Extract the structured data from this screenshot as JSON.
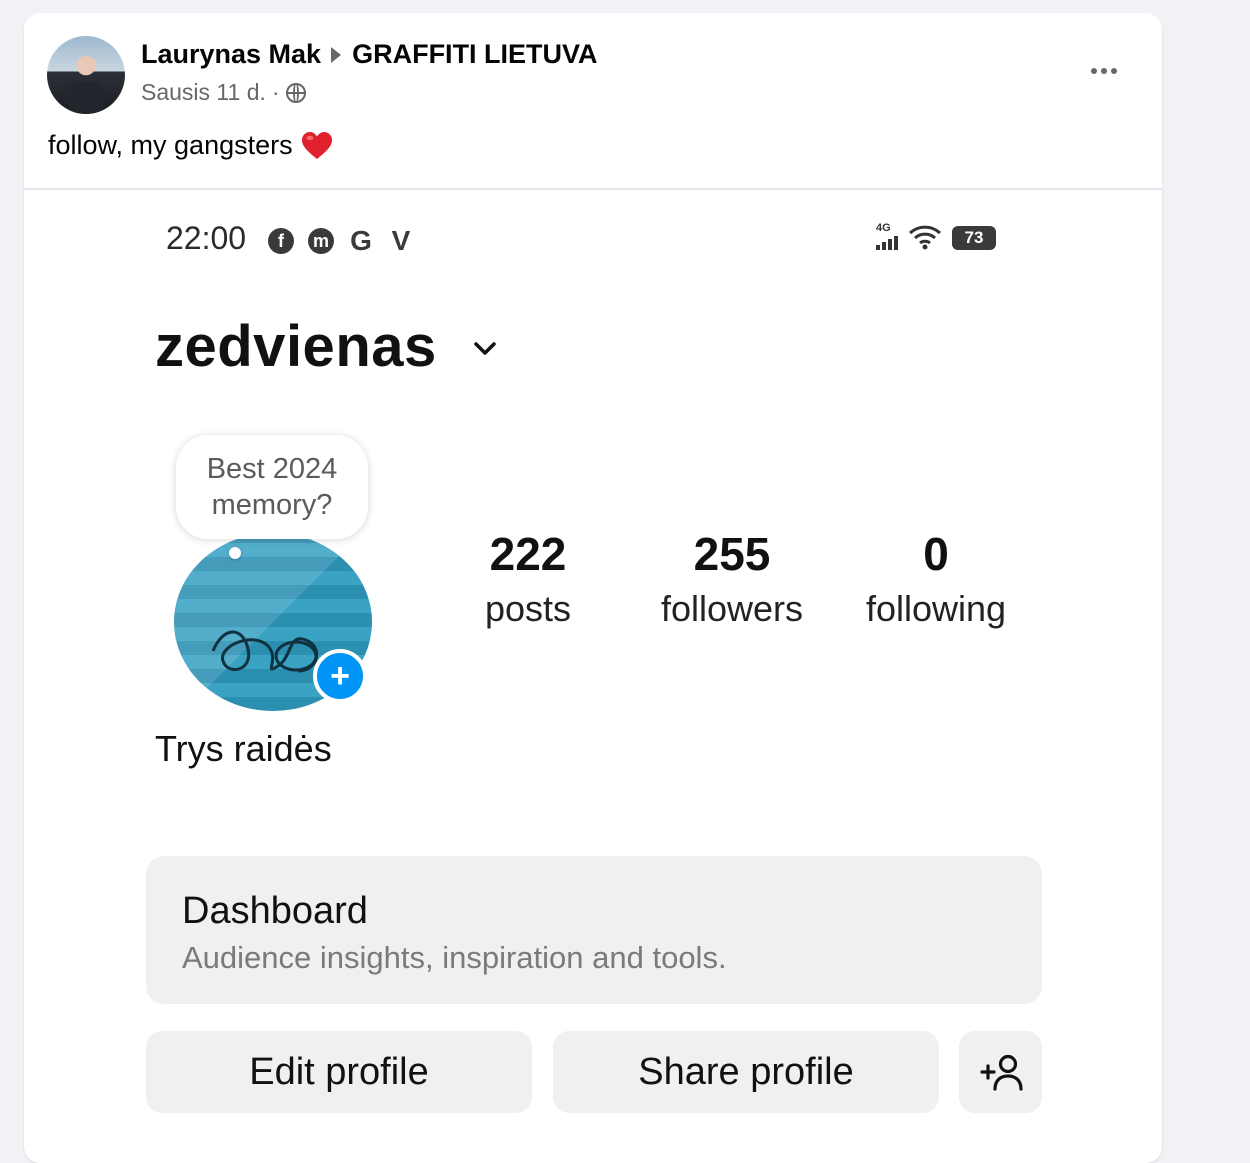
{
  "post": {
    "author": "Laurynas Mak",
    "group": "GRAFFITI LIETUVA",
    "date": "Sausis 11 d.",
    "separator": "·",
    "privacy_icon": "globe-icon",
    "more_icon": "more-options-icon",
    "text": "follow, my gangsters",
    "emoji": "heart-emoji"
  },
  "screenshot": {
    "status_bar": {
      "time": "22:00",
      "app_icons": [
        "f",
        "m",
        "G",
        "V"
      ],
      "network": "4G",
      "battery": "73"
    },
    "username": "zedvienas",
    "note": "Best 2024 memory?",
    "stats": [
      {
        "value": "222",
        "label": "posts"
      },
      {
        "value": "255",
        "label": "followers"
      },
      {
        "value": "0",
        "label": "following"
      }
    ],
    "display_name": "Trys raidės",
    "dashboard": {
      "title": "Dashboard",
      "subtitle": "Audience insights, inspiration and tools."
    },
    "buttons": {
      "edit": "Edit profile",
      "share": "Share profile",
      "add_person_icon": "add-person-icon"
    },
    "add_story_glyph": "+"
  },
  "colors": {
    "page_bg": "#f0f2f5",
    "ig_blue": "#0095f6",
    "button_bg": "#eff0f2",
    "muted_text": "#65676b"
  }
}
